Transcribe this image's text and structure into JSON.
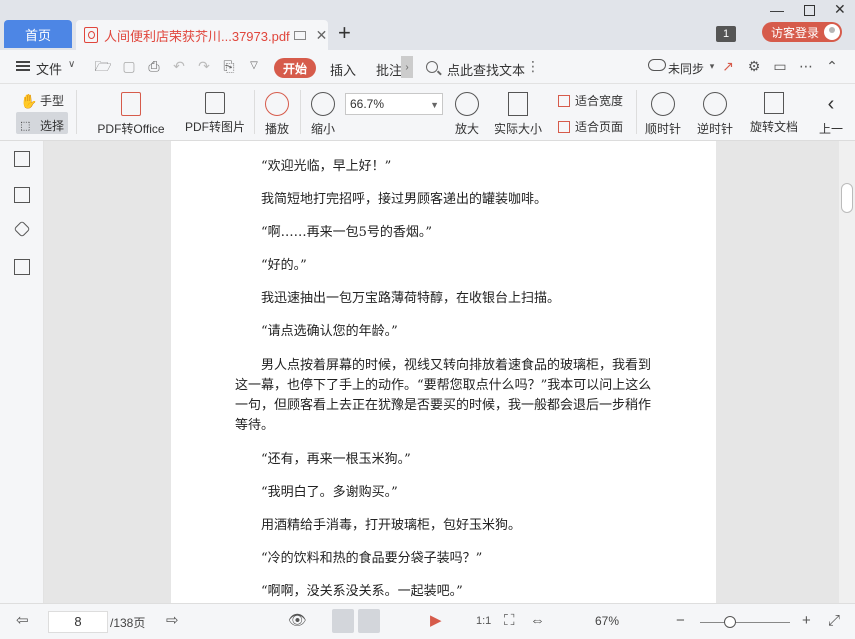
{
  "titlebar": {
    "home_tab": "首页",
    "doc_tab": "人间便利店荣获芥川...37973.pdf",
    "page_badge": "1",
    "guest_login": "访客登录"
  },
  "menubar": {
    "file": "文件",
    "tab_start": "开始",
    "tab_insert": "插入",
    "tab_annotate": "批注",
    "search": "点此查找文本",
    "sync": "未同步"
  },
  "toolbar": {
    "hand": "手型",
    "select": "选择",
    "pdf_to_office": "PDF转Office",
    "pdf_to_image": "PDF转图片",
    "play": "播放",
    "zoom_out": "缩小",
    "zoom_value": "66.7%",
    "zoom_in": "放大",
    "actual_size": "实际大小",
    "fit_width": "适合宽度",
    "fit_page": "适合页面",
    "rotate_cw": "顺时针",
    "rotate_ccw": "逆时针",
    "rotate_doc": "旋转文档",
    "prev": "上一"
  },
  "document": {
    "paragraphs": [
      "“欢迎光临，早上好！”",
      "我简短地打完招呼，接过男顾客递出的罐装咖啡。",
      "“啊……再来一包5号的香烟。”",
      "“好的。”",
      "我迅速抽出一包万宝路薄荷特醇，在收银台上扫描。",
      "“请点选确认您的年龄。”",
      "男人点按着屏幕的时候，视线又转向排放着速食品的玻璃柜，我看到这一幕，也停下了手上的动作。“要帮您取点什么吗？”我本可以问上这么一句，但顾客看上去正在犹豫是否要买的时候，我一般都会退后一步稍作等待。",
      "“还有，再来一根玉米狗。”",
      "“我明白了。多谢购买。”",
      "用酒精给手消毒，打开玻璃柜，包好玉米狗。",
      "“冷的饮料和热的食品要分袋子装吗？”",
      "“啊啊，没关系没关系。一起装吧。”"
    ]
  },
  "statusbar": {
    "page_current": "8",
    "page_total": "/138页",
    "zoom_percent": "67%"
  },
  "colors": {
    "accent": "#d65b4b",
    "home_tab": "#4d86e5",
    "doc_tab_text": "#e0463c"
  }
}
